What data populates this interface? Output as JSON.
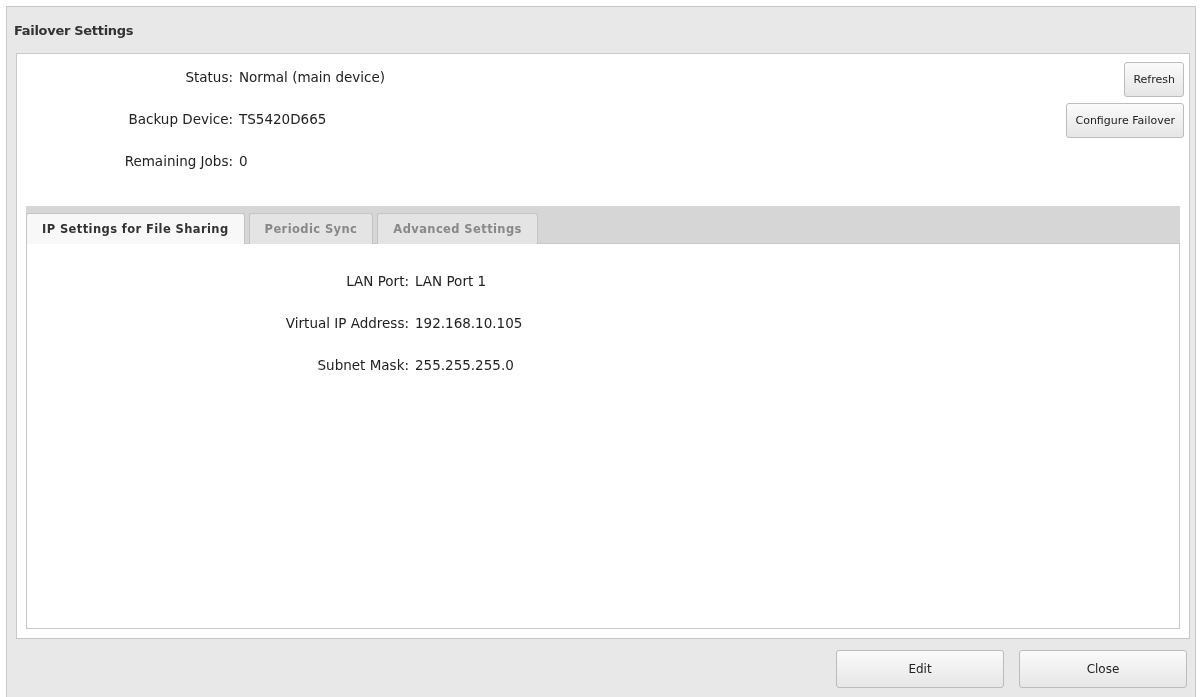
{
  "window": {
    "title": "Failover Settings"
  },
  "info": [
    {
      "label": "Status:",
      "value": "Normal (main device)"
    },
    {
      "label": "Backup Device:",
      "value": "TS5420D665"
    },
    {
      "label": "Remaining Jobs:",
      "value": "0"
    }
  ],
  "side_buttons": [
    "Refresh",
    "Configure Failover"
  ],
  "tabs": [
    {
      "label": "IP Settings for File Sharing",
      "selected": true
    },
    {
      "label": "Periodic Sync",
      "selected": false
    },
    {
      "label": "Advanced Settings",
      "selected": false
    }
  ],
  "fields": [
    {
      "label": "LAN Port:",
      "value": "LAN Port 1"
    },
    {
      "label": "Virtual IP Address:",
      "value": "192.168.10.105"
    },
    {
      "label": "Subnet Mask:",
      "value": "255.255.255.0"
    }
  ],
  "footer_buttons": [
    "Edit",
    "Close"
  ]
}
